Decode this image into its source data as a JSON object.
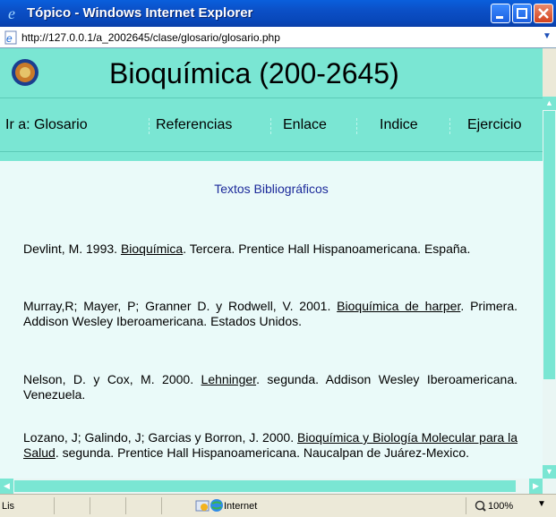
{
  "window": {
    "title": "Tópico - Windows Internet Explorer"
  },
  "address": {
    "url": "http://127.0.0.1/a_2002645/clase/glosario/glosario.php"
  },
  "site": {
    "title": "Bioquímica (200-2645)"
  },
  "nav": {
    "items": [
      "Ir a: Glosario",
      "Referencias",
      "Enlace",
      "Indice",
      "Ejercicio"
    ]
  },
  "section": {
    "title": "Textos Bibliográficos"
  },
  "references": [
    {
      "before": "Devlint, M. 1993. ",
      "link": "Bioquímica",
      "after": ". Tercera. Prentice Hall Hispanoamericana. España."
    },
    {
      "before": "Murray,R; Mayer, P; Granner D. y Rodwell, V. 2001. ",
      "link": "Bioquímica de harper",
      "after": ". Primera. Addison Wesley Iberoamericana. Estados Unidos."
    },
    {
      "before": "Nelson, D. y Cox, M. 2000. ",
      "link": "Lehninger",
      "after": ". segunda. Addison Wesley Iberoamericana. Venezuela."
    },
    {
      "before": "Lozano, J; Galindo, J; Garcias y Borron, J. 2000. ",
      "link": "Bioquímica y Biología Molecular para la Salud",
      "after": ". segunda. Prentice Hall Hispanoamericana. Naucalpan de Juárez-Mexico."
    }
  ],
  "status": {
    "text": "Lis",
    "zone": "Internet",
    "zoom": "100%"
  },
  "colors": {
    "accent": "#7ae6d3",
    "background": "#eafaf9",
    "section_title": "#1c2a9a"
  },
  "icons": [
    "ie-logo-icon",
    "page-icon",
    "university-seal-icon",
    "globe-icon",
    "zoom-icon"
  ]
}
